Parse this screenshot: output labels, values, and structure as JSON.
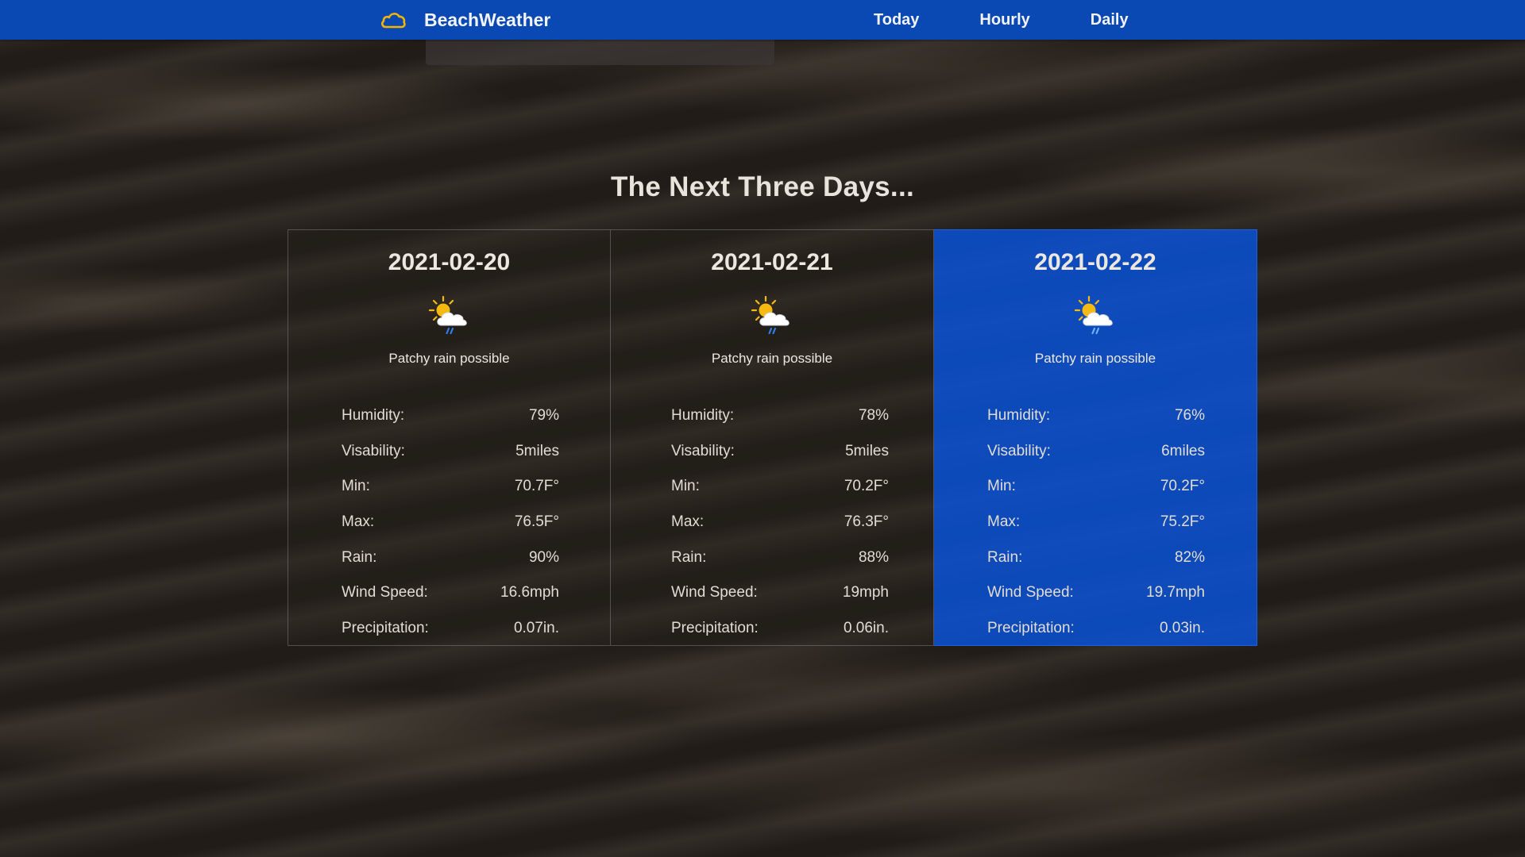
{
  "brand": {
    "name": "BeachWeather",
    "icon": "cloud-icon",
    "icon_color": "#f4b400"
  },
  "nav": [
    {
      "label": "Today"
    },
    {
      "label": "Hourly"
    },
    {
      "label": "Daily"
    }
  ],
  "section": {
    "title": "The Next Three Days..."
  },
  "colors": {
    "navbar": "#0a48b4",
    "active_card": "#0a52d4"
  },
  "days": [
    {
      "date": "2021-02-20",
      "icon": "patchy-rain-icon",
      "condition": "Patchy rain possible",
      "stats": [
        {
          "label": "Humidity:",
          "value": "79%"
        },
        {
          "label": "Visability:",
          "value": "5miles"
        },
        {
          "label": "Min:",
          "value": "70.7F°"
        },
        {
          "label": "Max:",
          "value": "76.5F°"
        },
        {
          "label": "Rain:",
          "value": "90%"
        },
        {
          "label": "Wind Speed:",
          "value": "16.6mph"
        },
        {
          "label": "Precipitation:",
          "value": "0.07in."
        }
      ]
    },
    {
      "date": "2021-02-21",
      "icon": "patchy-rain-icon",
      "condition": "Patchy rain possible",
      "stats": [
        {
          "label": "Humidity:",
          "value": "78%"
        },
        {
          "label": "Visability:",
          "value": "5miles"
        },
        {
          "label": "Min:",
          "value": "70.2F°"
        },
        {
          "label": "Max:",
          "value": "76.3F°"
        },
        {
          "label": "Rain:",
          "value": "88%"
        },
        {
          "label": "Wind Speed:",
          "value": "19mph"
        },
        {
          "label": "Precipitation:",
          "value": "0.06in."
        }
      ]
    },
    {
      "date": "2021-02-22",
      "icon": "patchy-rain-icon",
      "condition": "Patchy rain possible",
      "selected": true,
      "stats": [
        {
          "label": "Humidity:",
          "value": "76%"
        },
        {
          "label": "Visability:",
          "value": "6miles"
        },
        {
          "label": "Min:",
          "value": "70.2F°"
        },
        {
          "label": "Max:",
          "value": "75.2F°"
        },
        {
          "label": "Rain:",
          "value": "82%"
        },
        {
          "label": "Wind Speed:",
          "value": "19.7mph"
        },
        {
          "label": "Precipitation:",
          "value": "0.03in."
        }
      ]
    }
  ]
}
